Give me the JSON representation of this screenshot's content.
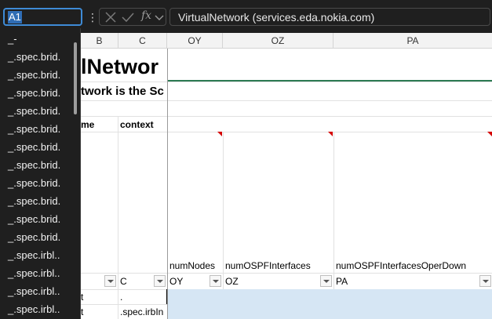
{
  "name_box": {
    "value": "A1"
  },
  "formula_bar": {
    "fx_label": "fx",
    "formula": "VirtualNetwork (services.eda.nokia.com)"
  },
  "column_headers": [
    "B",
    "C",
    "OY",
    "OZ",
    "PA"
  ],
  "sheet": {
    "title_partial": "lNetwor",
    "subtitle_partial": "twork is the Sc",
    "header_b_partial": "me",
    "header_c": "context",
    "field_headers": [
      "numNodes",
      "numOSPFInterfaces",
      "numOSPFInterfacesOperDown"
    ],
    "filter_row": [
      "",
      "C",
      "OY",
      "OZ",
      "PA"
    ],
    "data_rows": [
      {
        "b": "t",
        "c": "."
      },
      {
        "b": "t",
        "c": ".spec.irbIn"
      }
    ]
  },
  "name_dropdown": {
    "items": [
      "_-",
      "_.spec.brid.",
      "_.spec.brid.",
      "_.spec.brid.",
      "_.spec.brid.",
      "_.spec.brid.",
      "_.spec.brid.",
      "_.spec.brid.",
      "_.spec.brid.",
      "_.spec.brid.",
      "_.spec.brid.",
      "_.spec.brid.",
      "_.spec.irbl..",
      "_.spec.irbl..",
      "_.spec.irbl..",
      "_.spec.irbl.."
    ]
  },
  "colors": {
    "accent": "#3e8bd6",
    "title_rule": "#2c7a52",
    "selection_fill": "#d6e6f4",
    "comment_marker": "#d40000"
  }
}
